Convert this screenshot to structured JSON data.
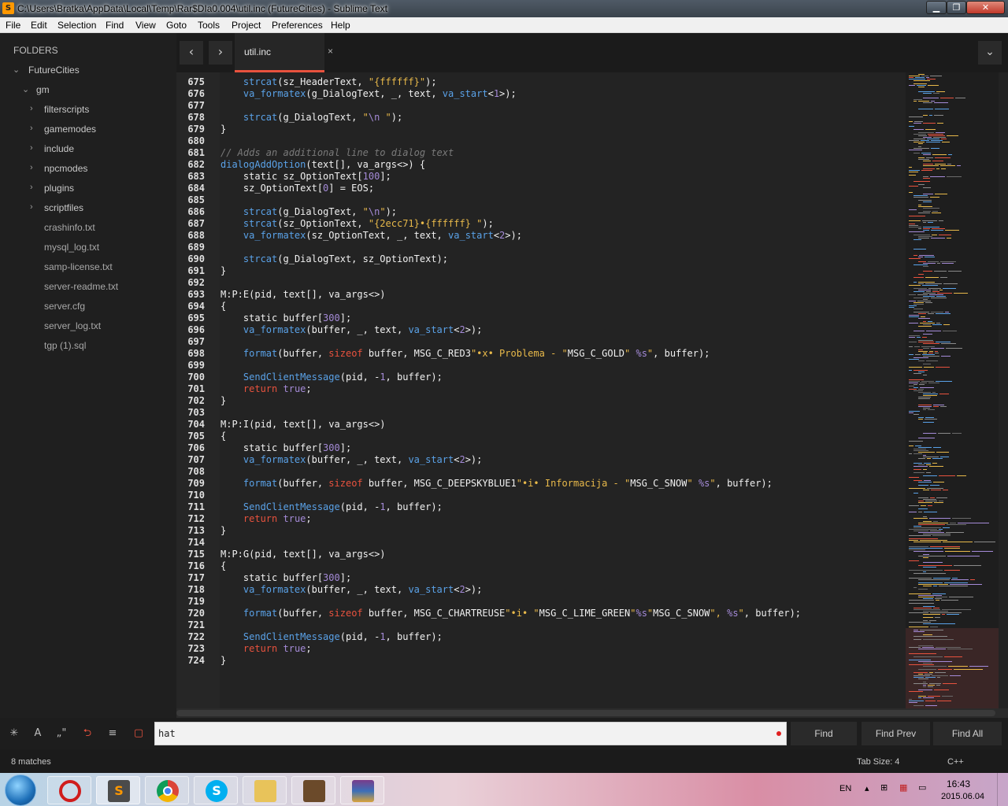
{
  "window": {
    "title": "C:\\Users\\Bratka\\AppData\\Local\\Temp\\Rar$DIa0.004\\util.inc (FutureCities) - Sublime Text",
    "app_icon": "S",
    "buttons": [
      "minimize-icon",
      "maximize-icon",
      "close-icon"
    ]
  },
  "menu": [
    "File",
    "Edit",
    "Selection",
    "Find",
    "View",
    "Goto",
    "Tools",
    "Project",
    "Preferences",
    "Help"
  ],
  "sidebar": {
    "header": "FOLDERS",
    "root": "FutureCities",
    "subroot": "gm",
    "folders": [
      "filterscripts",
      "gamemodes",
      "include",
      "npcmodes",
      "plugins",
      "scriptfiles"
    ],
    "files": [
      "crashinfo.txt",
      "mysql_log.txt",
      "samp-license.txt",
      "server-readme.txt",
      "server.cfg",
      "server_log.txt",
      "tgp (1).sql"
    ]
  },
  "tabs": {
    "back": "‹",
    "forward": "›",
    "active": "util.inc",
    "close": "×",
    "overflow": "⌄"
  },
  "code": [
    {
      "n": "675",
      "seg": [
        [
          "    ",
          ""
        ],
        [
          "strcat",
          "f"
        ],
        [
          "(sz_HeaderText, ",
          ""
        ],
        [
          "\"{ffffff}\"",
          "s"
        ],
        [
          ");",
          ""
        ]
      ]
    },
    {
      "n": "676",
      "seg": [
        [
          "    ",
          ""
        ],
        [
          "va_formatex",
          "f"
        ],
        [
          "(g_DialogText, _, text, ",
          ""
        ],
        [
          "va_start",
          "f"
        ],
        [
          "<",
          ""
        ],
        [
          "1",
          "n"
        ],
        [
          ">);",
          ""
        ]
      ]
    },
    {
      "n": "677",
      "seg": []
    },
    {
      "n": "678",
      "seg": [
        [
          "    ",
          ""
        ],
        [
          "strcat",
          "f"
        ],
        [
          "(g_DialogText, ",
          ""
        ],
        [
          "\"",
          "s"
        ],
        [
          "\\n",
          "n"
        ],
        [
          " \"",
          "s"
        ],
        [
          ");",
          ""
        ]
      ]
    },
    {
      "n": "679",
      "seg": [
        [
          "}",
          ""
        ]
      ]
    },
    {
      "n": "680",
      "seg": []
    },
    {
      "n": "681",
      "seg": [
        [
          "// Adds an additional line to dialog text",
          "c"
        ]
      ]
    },
    {
      "n": "682",
      "seg": [
        [
          "dialogAddOption",
          "f"
        ],
        [
          "(text[], va_args<>) {",
          ""
        ]
      ]
    },
    {
      "n": "683",
      "seg": [
        [
          "    static ",
          ""
        ],
        [
          "sz_OptionText[",
          ""
        ],
        [
          "100",
          "n"
        ],
        [
          "];",
          ""
        ]
      ]
    },
    {
      "n": "684",
      "seg": [
        [
          "    sz_OptionText[",
          ""
        ],
        [
          "0",
          "n"
        ],
        [
          "] = EOS;",
          ""
        ]
      ]
    },
    {
      "n": "685",
      "seg": []
    },
    {
      "n": "686",
      "seg": [
        [
          "    ",
          ""
        ],
        [
          "strcat",
          "f"
        ],
        [
          "(g_DialogText, ",
          ""
        ],
        [
          "\"",
          "s"
        ],
        [
          "\\n",
          "n"
        ],
        [
          "\"",
          "s"
        ],
        [
          ");",
          ""
        ]
      ]
    },
    {
      "n": "687",
      "seg": [
        [
          "    ",
          ""
        ],
        [
          "strcat",
          "f"
        ],
        [
          "(sz_OptionText, ",
          ""
        ],
        [
          "\"{2ecc71}•{ffffff} \"",
          "s"
        ],
        [
          ");",
          ""
        ]
      ]
    },
    {
      "n": "688",
      "seg": [
        [
          "    ",
          ""
        ],
        [
          "va_formatex",
          "f"
        ],
        [
          "(sz_OptionText, _, text, ",
          ""
        ],
        [
          "va_start",
          "f"
        ],
        [
          "<",
          ""
        ],
        [
          "2",
          "n"
        ],
        [
          ">);",
          ""
        ]
      ]
    },
    {
      "n": "689",
      "seg": []
    },
    {
      "n": "690",
      "seg": [
        [
          "    ",
          ""
        ],
        [
          "strcat",
          "f"
        ],
        [
          "(g_DialogText, sz_OptionText);",
          ""
        ]
      ]
    },
    {
      "n": "691",
      "seg": [
        [
          "}",
          ""
        ]
      ]
    },
    {
      "n": "692",
      "seg": []
    },
    {
      "n": "693",
      "seg": [
        [
          "M:P:E(pid, text[], va_args<>)",
          ""
        ]
      ]
    },
    {
      "n": "694",
      "seg": [
        [
          "{",
          ""
        ]
      ]
    },
    {
      "n": "695",
      "seg": [
        [
          "    static buffer[",
          ""
        ],
        [
          "300",
          "n"
        ],
        [
          "];",
          ""
        ]
      ]
    },
    {
      "n": "696",
      "seg": [
        [
          "    ",
          ""
        ],
        [
          "va_formatex",
          "f"
        ],
        [
          "(buffer, _, text, ",
          ""
        ],
        [
          "va_start",
          "f"
        ],
        [
          "<",
          ""
        ],
        [
          "2",
          "n"
        ],
        [
          ">);",
          ""
        ]
      ]
    },
    {
      "n": "697",
      "seg": []
    },
    {
      "n": "698",
      "seg": [
        [
          "    ",
          ""
        ],
        [
          "format",
          "f"
        ],
        [
          "(buffer, ",
          ""
        ],
        [
          "sizeof",
          "k"
        ],
        [
          " buffer, MSG_C_RED3",
          ""
        ],
        [
          "\"•x• Problema - \"",
          "s"
        ],
        [
          "MSG_C_GOLD",
          ""
        ],
        [
          "\" ",
          "s"
        ],
        [
          "%s",
          "n"
        ],
        [
          "\"",
          "s"
        ],
        [
          ", buffer);",
          ""
        ]
      ]
    },
    {
      "n": "699",
      "seg": []
    },
    {
      "n": "700",
      "seg": [
        [
          "    ",
          ""
        ],
        [
          "SendClientMessage",
          "f"
        ],
        [
          "(pid, -",
          ""
        ],
        [
          "1",
          "n"
        ],
        [
          ", buffer);",
          ""
        ]
      ]
    },
    {
      "n": "701",
      "seg": [
        [
          "    ",
          ""
        ],
        [
          "return",
          "k"
        ],
        [
          " ",
          ""
        ],
        [
          "true",
          "n"
        ],
        [
          ";",
          ""
        ]
      ]
    },
    {
      "n": "702",
      "seg": [
        [
          "}",
          ""
        ]
      ]
    },
    {
      "n": "703",
      "seg": []
    },
    {
      "n": "704",
      "seg": [
        [
          "M:P:I(pid, text[], va_args<>)",
          ""
        ]
      ]
    },
    {
      "n": "705",
      "seg": [
        [
          "{",
          ""
        ]
      ]
    },
    {
      "n": "706",
      "seg": [
        [
          "    static buffer[",
          ""
        ],
        [
          "300",
          "n"
        ],
        [
          "];",
          ""
        ]
      ]
    },
    {
      "n": "707",
      "seg": [
        [
          "    ",
          ""
        ],
        [
          "va_formatex",
          "f"
        ],
        [
          "(buffer, _, text, ",
          ""
        ],
        [
          "va_start",
          "f"
        ],
        [
          "<",
          ""
        ],
        [
          "2",
          "n"
        ],
        [
          ">);",
          ""
        ]
      ]
    },
    {
      "n": "708",
      "seg": []
    },
    {
      "n": "709",
      "seg": [
        [
          "    ",
          ""
        ],
        [
          "format",
          "f"
        ],
        [
          "(buffer, ",
          ""
        ],
        [
          "sizeof",
          "k"
        ],
        [
          " buffer, MSG_C_DEEPSKYBLUE1",
          ""
        ],
        [
          "\"•i• Informacija - \"",
          "s"
        ],
        [
          "MSG_C_SNOW",
          ""
        ],
        [
          "\" ",
          "s"
        ],
        [
          "%s",
          "n"
        ],
        [
          "\"",
          "s"
        ],
        [
          ", buffer);",
          ""
        ]
      ]
    },
    {
      "n": "710",
      "seg": []
    },
    {
      "n": "711",
      "seg": [
        [
          "    ",
          ""
        ],
        [
          "SendClientMessage",
          "f"
        ],
        [
          "(pid, -",
          ""
        ],
        [
          "1",
          "n"
        ],
        [
          ", buffer);",
          ""
        ]
      ]
    },
    {
      "n": "712",
      "seg": [
        [
          "    ",
          ""
        ],
        [
          "return",
          "k"
        ],
        [
          " ",
          ""
        ],
        [
          "true",
          "n"
        ],
        [
          ";",
          ""
        ]
      ]
    },
    {
      "n": "713",
      "seg": [
        [
          "}",
          ""
        ]
      ]
    },
    {
      "n": "714",
      "seg": []
    },
    {
      "n": "715",
      "seg": [
        [
          "M:P:G(pid, text[], va_args<>)",
          ""
        ]
      ]
    },
    {
      "n": "716",
      "seg": [
        [
          "{",
          ""
        ]
      ]
    },
    {
      "n": "717",
      "seg": [
        [
          "    static buffer[",
          ""
        ],
        [
          "300",
          "n"
        ],
        [
          "];",
          ""
        ]
      ]
    },
    {
      "n": "718",
      "seg": [
        [
          "    ",
          ""
        ],
        [
          "va_formatex",
          "f"
        ],
        [
          "(buffer, _, text, ",
          ""
        ],
        [
          "va_start",
          "f"
        ],
        [
          "<",
          ""
        ],
        [
          "2",
          "n"
        ],
        [
          ">);",
          ""
        ]
      ]
    },
    {
      "n": "719",
      "seg": []
    },
    {
      "n": "720",
      "seg": [
        [
          "    ",
          ""
        ],
        [
          "format",
          "f"
        ],
        [
          "(buffer, ",
          ""
        ],
        [
          "sizeof",
          "k"
        ],
        [
          " buffer, MSG_C_CHARTREUSE",
          ""
        ],
        [
          "\"•i• \"",
          "s"
        ],
        [
          "MSG_C_LIME_GREEN",
          ""
        ],
        [
          "\"",
          "s"
        ],
        [
          "%s",
          "n"
        ],
        [
          "\"",
          "s"
        ],
        [
          "MSG_C_SNOW",
          ""
        ],
        [
          "\", ",
          "s"
        ],
        [
          "%s",
          "n"
        ],
        [
          "\"",
          "s"
        ],
        [
          ", buffer);",
          ""
        ]
      ]
    },
    {
      "n": "721",
      "seg": []
    },
    {
      "n": "722",
      "seg": [
        [
          "    ",
          ""
        ],
        [
          "SendClientMessage",
          "f"
        ],
        [
          "(pid, -",
          ""
        ],
        [
          "1",
          "n"
        ],
        [
          ", buffer);",
          ""
        ]
      ]
    },
    {
      "n": "723",
      "seg": [
        [
          "    ",
          ""
        ],
        [
          "return",
          "k"
        ],
        [
          " ",
          ""
        ],
        [
          "true",
          "n"
        ],
        [
          ";",
          ""
        ]
      ]
    },
    {
      "n": "724",
      "seg": [
        [
          "}",
          ""
        ]
      ]
    }
  ],
  "find": {
    "options": [
      "regex-icon",
      "case-icon",
      "whole-word-icon",
      "wrap-icon",
      "in-selection-icon",
      "highlight-icon"
    ],
    "value": "hat",
    "find_label": "Find",
    "find_prev_label": "Find Prev",
    "find_all_label": "Find All"
  },
  "status": {
    "matches": "8 matches",
    "tab_size": "Tab Size: 4",
    "syntax": "C++"
  },
  "taskbar": {
    "apps": [
      "opera-icon",
      "sublime-text-icon",
      "chrome-icon",
      "skype-icon",
      "file-explorer-icon",
      "game-icon",
      "winrar-icon"
    ],
    "language": "EN",
    "time": "16:43",
    "date": "2015.06.04"
  }
}
